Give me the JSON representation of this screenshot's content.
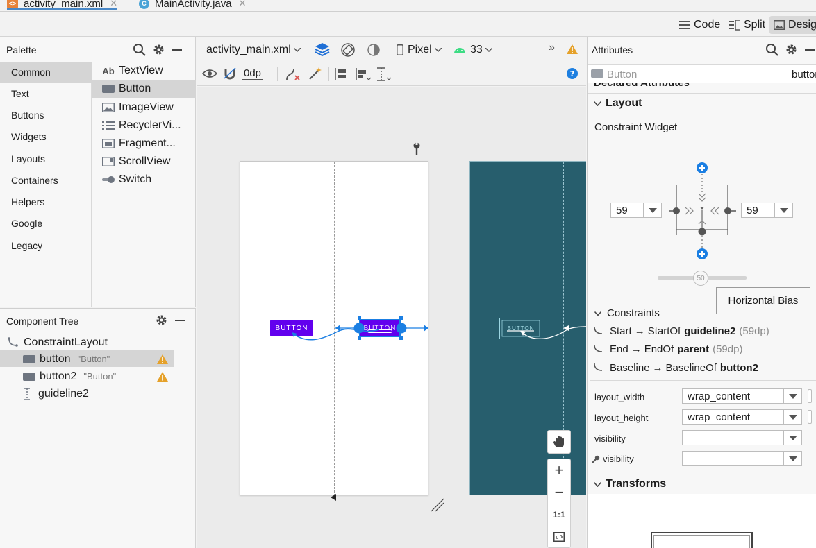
{
  "tabs": [
    {
      "label": "activity_main.xml",
      "badge": "<>",
      "badge_color": "#e8833a"
    },
    {
      "label": "MainActivity.java",
      "badge": "C",
      "badge_color": "#4aa3d6"
    }
  ],
  "view_modes": {
    "code": "Code",
    "split": "Split",
    "design": "Design"
  },
  "palette": {
    "title": "Palette",
    "categories": [
      "Common",
      "Text",
      "Buttons",
      "Widgets",
      "Layouts",
      "Containers",
      "Helpers",
      "Google",
      "Legacy"
    ],
    "selected_category": "Common",
    "items": [
      {
        "label": "TextView",
        "icon": "textview-icon"
      },
      {
        "label": "Button",
        "icon": "button-icon"
      },
      {
        "label": "ImageView",
        "icon": "imageview-icon"
      },
      {
        "label": "RecyclerVi...",
        "icon": "recyclerview-icon"
      },
      {
        "label": "Fragment...",
        "icon": "fragment-icon"
      },
      {
        "label": "ScrollView",
        "icon": "scrollview-icon"
      },
      {
        "label": "Switch",
        "icon": "switch-icon"
      }
    ],
    "selected_item": "Button"
  },
  "component_tree": {
    "title": "Component Tree",
    "root": "ConstraintLayout",
    "children": [
      {
        "label": "button",
        "hint": "\"Button\"",
        "warning": true
      },
      {
        "label": "button2",
        "hint": "\"Button\"",
        "warning": true
      },
      {
        "label": "guideline2",
        "hint": "",
        "warning": false
      }
    ]
  },
  "design_toolbar": {
    "file": "activity_main.xml",
    "device": "Pixel",
    "api": "33",
    "margin": "0dp",
    "overflow": "»"
  },
  "canvas": {
    "button_text": "BUTTON",
    "zoom_reset": "1:1",
    "accent": "#6200ee",
    "selection": "#1b7fe3",
    "blueprint_bg": "#275e6d"
  },
  "attributes": {
    "title": "Attributes",
    "widget_type": "Button",
    "widget_id": "button",
    "declared_label": "Declared Attributes",
    "layout_section": "Layout",
    "constraint_widget_label": "Constraint Widget",
    "margin_left": "59",
    "margin_right": "59",
    "bias_value": "50",
    "bias_tooltip": "Horizontal Bias",
    "constraints_label": "Constraints",
    "constraints": [
      {
        "side": "Start",
        "target_attr": "StartOf",
        "target": "guideline2",
        "margin": "(59dp)"
      },
      {
        "side": "End",
        "target_attr": "EndOf",
        "target": "parent",
        "margin": "(59dp)"
      },
      {
        "side": "Baseline",
        "target_attr": "BaselineOf",
        "target": "button2",
        "margin": ""
      }
    ],
    "rows": [
      {
        "label": "layout_width",
        "value": "wrap_content"
      },
      {
        "label": "layout_height",
        "value": "wrap_content"
      },
      {
        "label": "visibility",
        "value": ""
      },
      {
        "label": "visibility",
        "value": "",
        "tools": true
      }
    ],
    "transforms_section": "Transforms"
  }
}
